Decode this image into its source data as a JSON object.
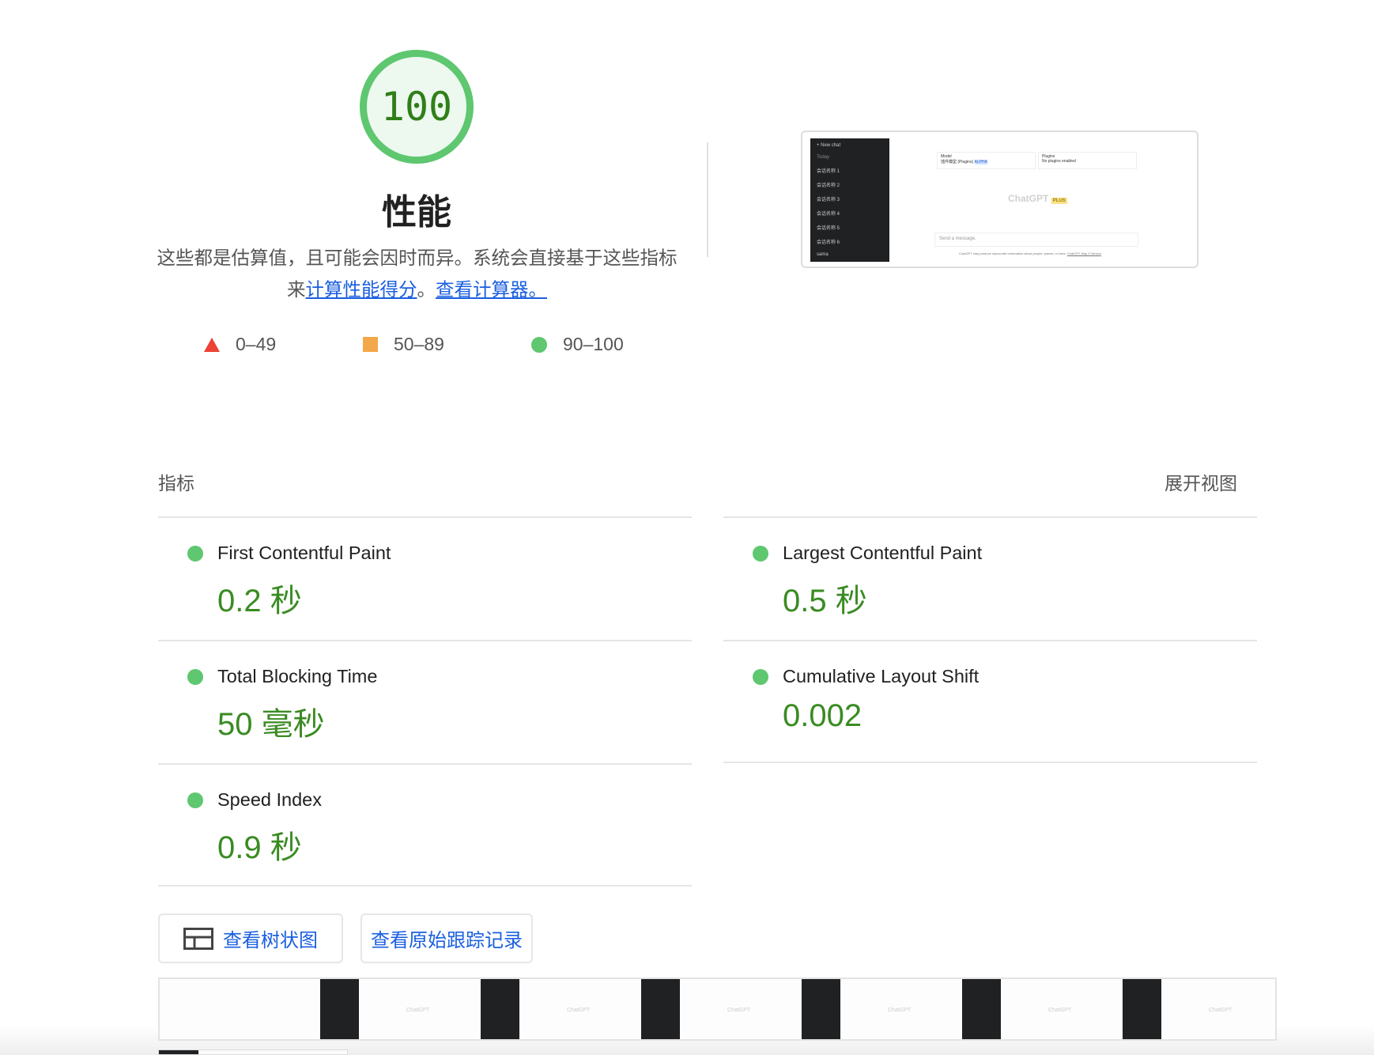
{
  "score": {
    "value": "100",
    "title": "性能",
    "desc_text": "这些都是估算值，且可能会因时而异。系统会直接基于这些指标来",
    "link1": "计算性能得分",
    "sep": "。",
    "link2": "查看计算器。"
  },
  "legend": [
    {
      "icon": "triangle",
      "range": "0–49",
      "color": "#eb4335"
    },
    {
      "icon": "square",
      "range": "50–89",
      "color": "#f4a64a"
    },
    {
      "icon": "circle",
      "range": "90–100",
      "color": "#5ec770"
    }
  ],
  "thumbnail": {
    "new_chat": "+ New chat",
    "today": "Today",
    "chats": [
      "会话名称 1",
      "会话名称 2",
      "会话名称 3",
      "会话名称 4",
      "会话名称 5",
      "会话名称 6"
    ],
    "user": "sama",
    "model_label": "Model",
    "model_value": "插件模型 (Plugins)",
    "model_badge": "ALPHA",
    "plugins_label": "Plugins",
    "plugins_value": "No plugins enabled",
    "brand": "ChatGPT",
    "brand_badge": "PLUS",
    "input_placeholder": "Send a message.",
    "footer": "ChatGPT may produce inaccurate information about people, places, or facts.",
    "footer_link": "ChatGPT May 3 Version"
  },
  "metrics_section": {
    "title": "指标",
    "expand": "展开视图"
  },
  "metrics": [
    {
      "label": "First Contentful Paint",
      "value": "0.2 秒",
      "status": "pass"
    },
    {
      "label": "Largest Contentful Paint",
      "value": "0.5 秒",
      "status": "pass"
    },
    {
      "label": "Total Blocking Time",
      "value": "50 毫秒",
      "status": "pass"
    },
    {
      "label": "Cumulative Layout Shift",
      "value": "0.002",
      "status": "pass"
    },
    {
      "label": "Speed Index",
      "value": "0.9 秒",
      "status": "pass"
    }
  ],
  "buttons": {
    "treemap": "查看树状图",
    "trace": "查看原始跟踪记录"
  },
  "colors": {
    "pass": "#5ec770",
    "pass_text": "#3a8b22",
    "link": "#1a5fe0"
  }
}
